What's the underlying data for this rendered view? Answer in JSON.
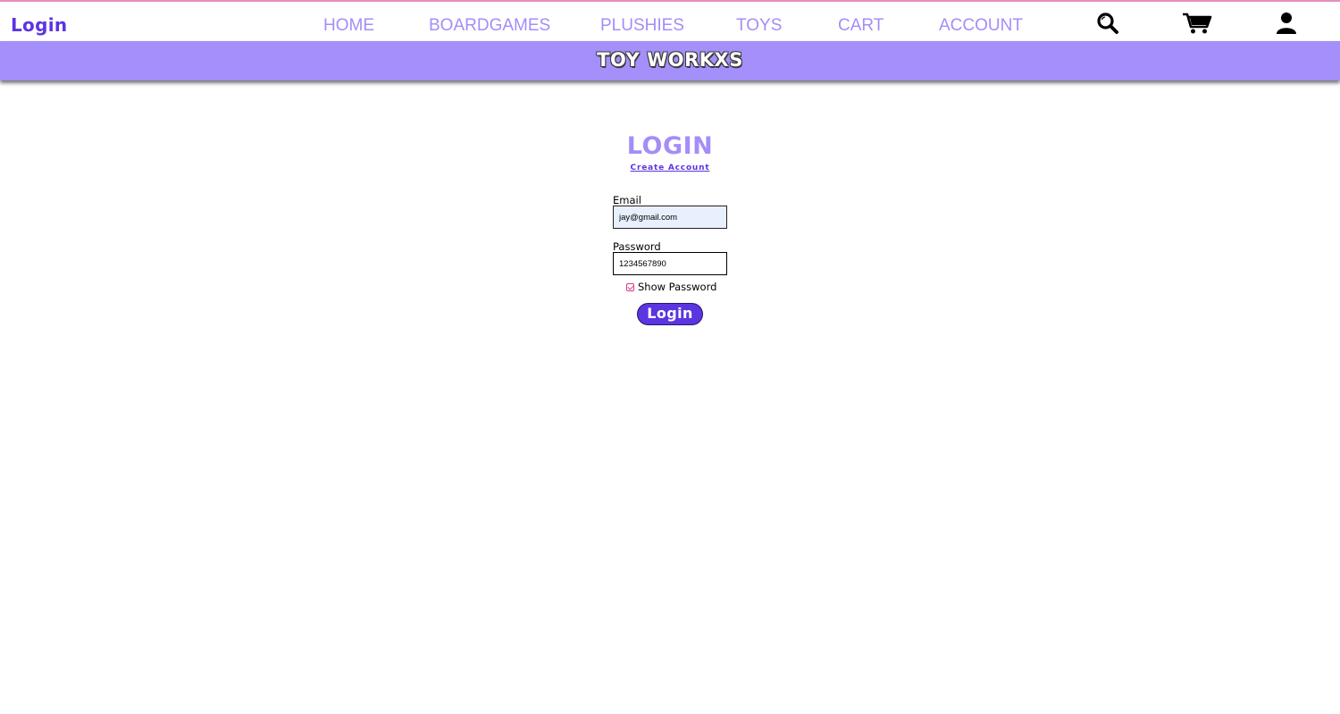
{
  "header": {
    "brand": "Login",
    "nav": [
      {
        "label": "HOME"
      },
      {
        "label": "BOARDGAMES"
      },
      {
        "label": "PLUSHIES"
      },
      {
        "label": "TOYS"
      },
      {
        "label": "CART"
      },
      {
        "label": "ACCOUNT"
      }
    ],
    "icons": [
      "search-icon",
      "cart-icon",
      "user-icon"
    ]
  },
  "banner": {
    "title": "TOY WORKXS"
  },
  "login": {
    "title": "LOGIN",
    "create_account_link": "Create Account",
    "email_label": "Email",
    "email_value": "jay@gmail.com",
    "password_label": "Password",
    "password_value": "1234567890",
    "show_password_label": "Show Password",
    "show_password_checked": true,
    "submit_label": "Login"
  },
  "colors": {
    "accent": "#5b35e0",
    "nav_text": "#a58df8",
    "banner_bg": "#a48ffb",
    "checkbox": "#d13b8f"
  }
}
